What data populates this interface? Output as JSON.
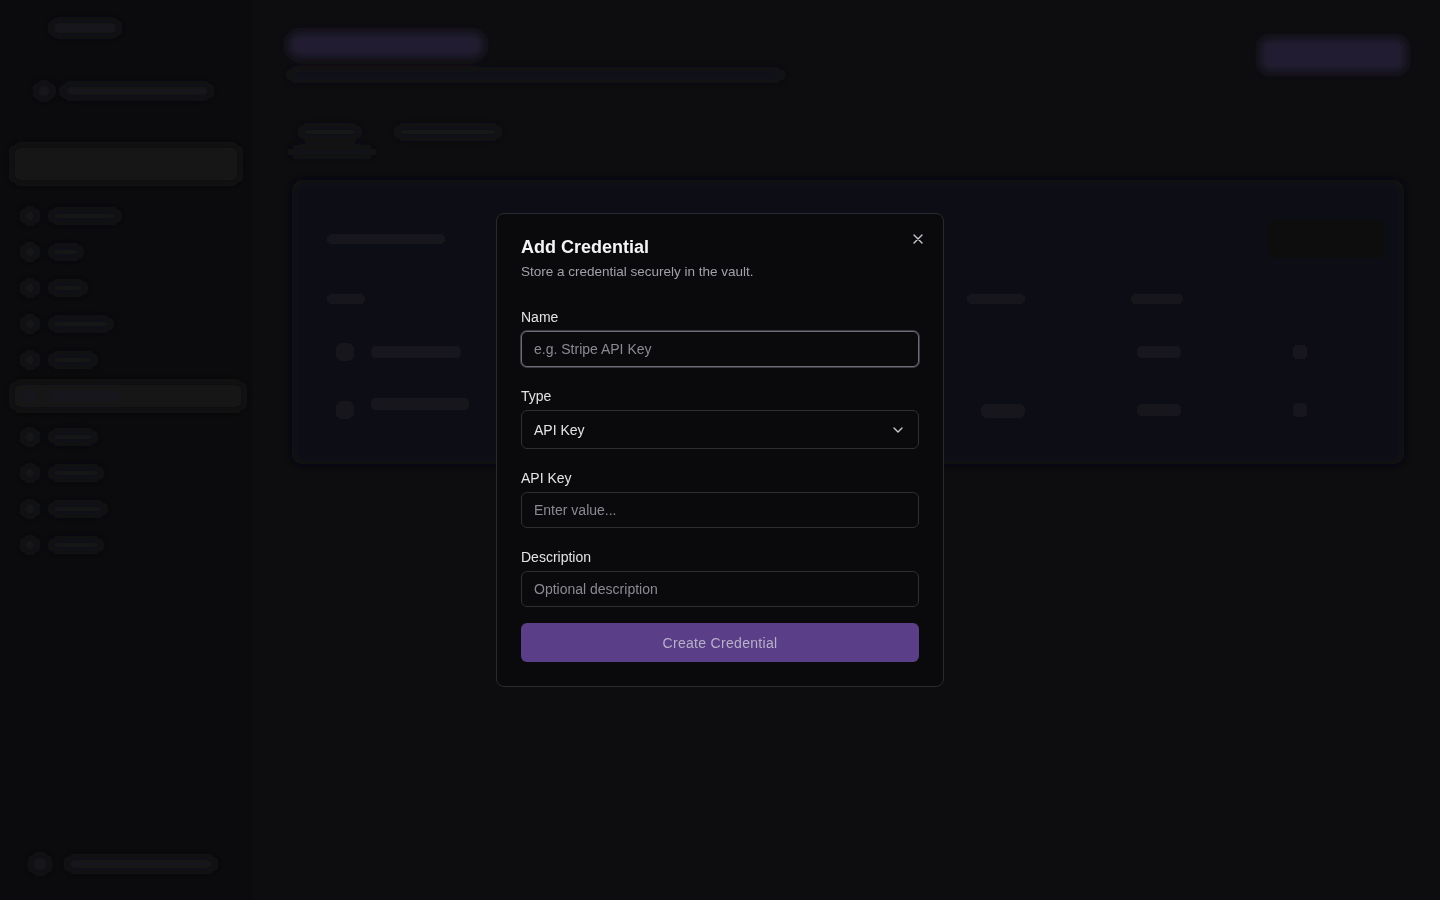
{
  "dialog": {
    "title": "Add Credential",
    "subtitle": "Store a credential securely in the vault.",
    "fields": [
      {
        "kind": "text",
        "label": "Name",
        "placeholder": "e.g. Stripe API Key",
        "focused": true
      },
      {
        "kind": "select",
        "label": "Type",
        "value": "API Key"
      },
      {
        "kind": "text",
        "label": "API Key",
        "placeholder": "Enter value...",
        "focused": false
      },
      {
        "kind": "text",
        "label": "Description",
        "placeholder": "Optional description",
        "focused": false
      }
    ],
    "submit": {
      "label": "Create Credential",
      "disabled": true
    }
  }
}
